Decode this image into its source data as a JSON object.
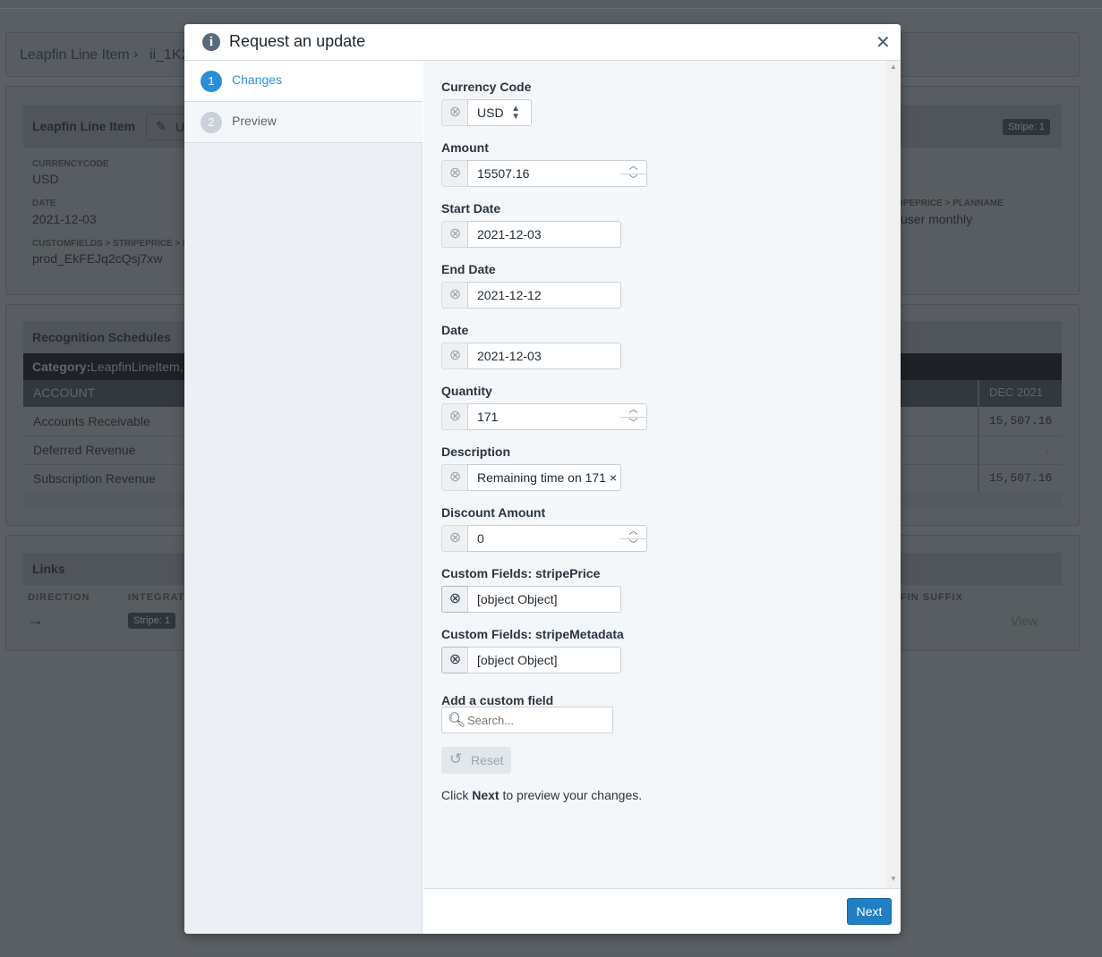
{
  "background": {
    "breadcrumb": [
      "Leapfin Line Item",
      "ii_1K2"
    ],
    "detail": {
      "title": "Leapfin Line Item",
      "edit_label": "U",
      "badge": "Stripe: 1",
      "fields": [
        {
          "label": "CURRENCYCODE",
          "value": "USD"
        },
        {
          "label": "DATE",
          "value": "2021-12-03"
        },
        {
          "label": "CUSTOMFIELDS > STRIPEPRICE > PR",
          "value": "prod_EkFEJq2cQsj7xw"
        },
        {
          "label": "IPEPRICE > PLANNAME",
          "value": "user monthly"
        }
      ]
    },
    "schedules": {
      "title": "Recognition Schedules",
      "category_label": "Category:",
      "category_value": "LeapfinLineItem,",
      "col_account": "ACCOUNT",
      "col_month": "DEC 2021",
      "rows": [
        {
          "account": "Accounts Receivable",
          "value": "15,507.16"
        },
        {
          "account": "Deferred Revenue",
          "value": "-"
        },
        {
          "account": "Subscription Revenue",
          "value": "15,507.16"
        }
      ]
    },
    "links": {
      "title": "Links",
      "col_direction": "DIRECTION",
      "col_integration": "INTEGRATI",
      "col_suffix": "FIN SUFFIX",
      "badge": "Stripe: 1",
      "view": "View"
    }
  },
  "modal": {
    "title": "Request an update",
    "steps": [
      {
        "num": "1",
        "label": "Changes",
        "active": true
      },
      {
        "num": "2",
        "label": "Preview",
        "active": false
      }
    ],
    "fields": [
      {
        "label": "Currency Code",
        "value": "USD",
        "type": "select"
      },
      {
        "label": "Amount",
        "value": "15507.16",
        "type": "number"
      },
      {
        "label": "Start Date",
        "value": "2021-12-03",
        "type": "text"
      },
      {
        "label": "End Date",
        "value": "2021-12-12",
        "type": "text"
      },
      {
        "label": "Date",
        "value": "2021-12-03",
        "type": "text"
      },
      {
        "label": "Quantity",
        "value": "171",
        "type": "number"
      },
      {
        "label": "Description",
        "value": "Remaining time on 171 ×",
        "type": "text"
      },
      {
        "label": "Discount Amount",
        "value": "0",
        "type": "number"
      },
      {
        "label": "Custom Fields: stripePrice",
        "value": "[object Object]",
        "type": "text"
      },
      {
        "label": "Custom Fields: stripeMetadata",
        "value": "[object Object]",
        "type": "text"
      }
    ],
    "add_custom_label": "Add a custom field",
    "search_placeholder": "Search...",
    "reset_label": "Reset",
    "hint_pre": "Click ",
    "hint_bold": "Next",
    "hint_post": " to preview your changes.",
    "next_label": "Next"
  },
  "colors": {
    "accent": "#1f7fc2",
    "step_active": "#2b8fd6",
    "step_inactive": "#c9d2da"
  }
}
